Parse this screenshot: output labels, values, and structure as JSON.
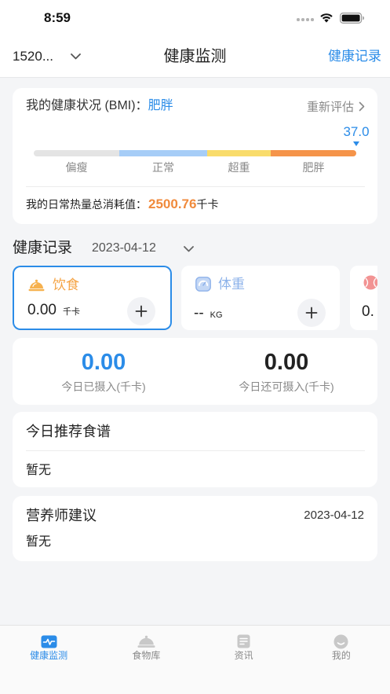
{
  "status_bar": {
    "time": "8:59"
  },
  "nav": {
    "account": "1520...",
    "title": "健康监测",
    "records_link": "健康记录"
  },
  "bmi": {
    "label": "我的健康状况 (BMI)：",
    "status": "肥胖",
    "reassess": "重新评估",
    "value": "37.0",
    "scale": [
      {
        "label": "偏瘦",
        "color": "#e4e4e4"
      },
      {
        "label": "正常",
        "color": "#a6cdf7"
      },
      {
        "label": "超重",
        "color": "#f9dc6b"
      },
      {
        "label": "肥胖",
        "color": "#f5944a"
      }
    ],
    "calorie_label": "我的日常热量总消耗值：",
    "calorie_value": "2500.76",
    "calorie_unit": "千卡"
  },
  "records": {
    "title": "健康记录",
    "date": "2023-04-12",
    "cards": [
      {
        "label": "饮食",
        "value": "0.00",
        "unit": "千卡",
        "selected": true,
        "color": "#f5a445",
        "icon": "cloche-icon"
      },
      {
        "label": "体重",
        "value": "--",
        "unit": "KG",
        "selected": false,
        "color": "#8cb2ea",
        "icon": "scale-icon"
      },
      {
        "value": "0.",
        "icon": "ball-icon"
      }
    ]
  },
  "intake": {
    "consumed_value": "0.00",
    "consumed_label": "今日已摄入(千卡)",
    "remaining_value": "0.00",
    "remaining_label": "今日还可摄入(千卡)"
  },
  "recipe": {
    "title": "今日推荐食谱",
    "content": "暂无"
  },
  "advice": {
    "title": "营养师建议",
    "date": "2023-04-12",
    "content": "暂无"
  },
  "tabbar": {
    "items": [
      {
        "label": "健康监测",
        "icon": "heartbeat-icon",
        "active": true
      },
      {
        "label": "食物库",
        "icon": "cloche-icon",
        "active": false
      },
      {
        "label": "资讯",
        "icon": "news-icon",
        "active": false
      },
      {
        "label": "我的",
        "icon": "face-icon",
        "active": false
      }
    ]
  },
  "colors": {
    "accent": "#2b8ce8",
    "calorie": "#f08a3c",
    "text": "#222222",
    "muted": "#8a8a8a"
  }
}
